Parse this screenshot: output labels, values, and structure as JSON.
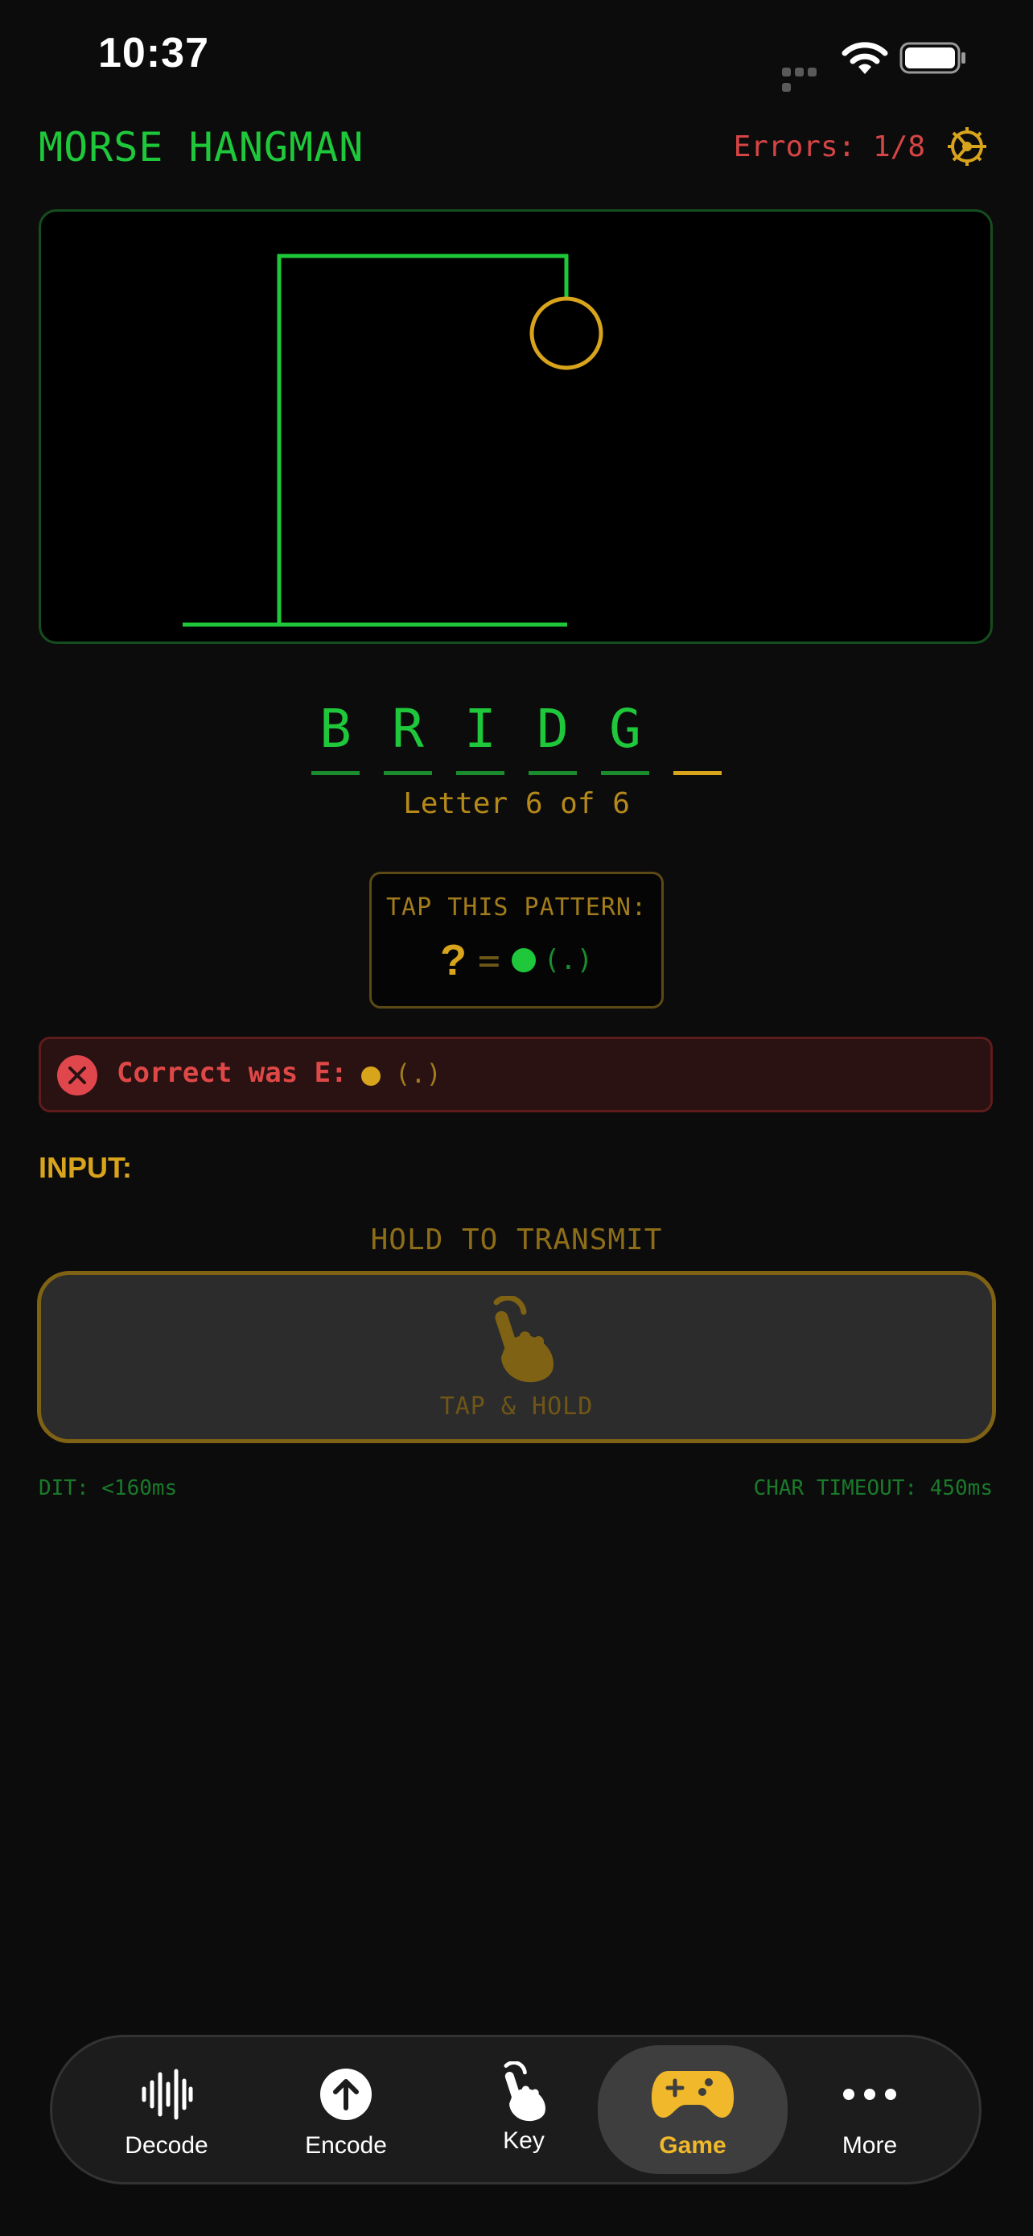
{
  "status_bar": {
    "time": "10:37"
  },
  "header": {
    "title": "MORSE HANGMAN",
    "errors": "Errors: 1/8"
  },
  "colors": {
    "green": "#1fc83a",
    "amber": "#d8a41c",
    "error_red": "#d64545",
    "background": "#0c0c0c"
  },
  "word": {
    "letters": [
      "B",
      "R",
      "I",
      "D",
      "G",
      ""
    ],
    "progress": "Letter 6 of 6"
  },
  "pattern": {
    "title": "TAP THIS PATTERN:",
    "unknown": "?",
    "equals": "=",
    "code": "(.)"
  },
  "feedback": {
    "text": "Correct was E:",
    "code": "(.)"
  },
  "input": {
    "label": "INPUT:",
    "hold_label": "HOLD TO TRANSMIT",
    "button_label": "TAP & HOLD",
    "dit": "DIT: <160ms",
    "char_timeout": "CHAR TIMEOUT: 450ms"
  },
  "tabs": [
    {
      "label": "Decode",
      "icon": "waveform-icon"
    },
    {
      "label": "Encode",
      "icon": "arrow-up-circle-icon"
    },
    {
      "label": "Key",
      "icon": "hand-tap-icon"
    },
    {
      "label": "Game",
      "icon": "gamecontroller-icon",
      "active": true
    },
    {
      "label": "More",
      "icon": "ellipsis-icon"
    }
  ]
}
